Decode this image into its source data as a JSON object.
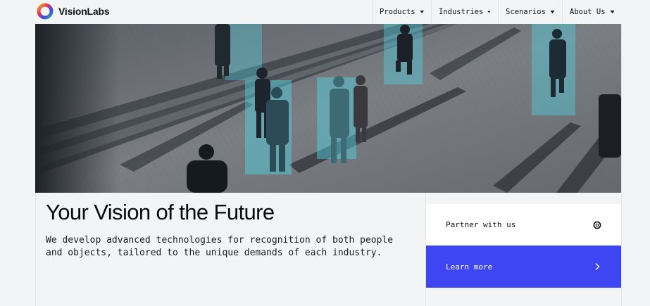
{
  "brand": {
    "name": "VisionLabs",
    "logo_icon": "ring-logo-icon",
    "logo_colors": [
      "#e8344e",
      "#f5a623",
      "#3d46f2",
      "#2bb673"
    ]
  },
  "nav": {
    "items": [
      {
        "label": "Products",
        "icon": "chevron-down-icon"
      },
      {
        "label": "Industries",
        "icon": "chevron-down-icon"
      },
      {
        "label": "Scenarios",
        "icon": "chevron-down-icon"
      },
      {
        "label": "About Us",
        "icon": "chevron-down-icon"
      }
    ]
  },
  "hero": {
    "image_subject": "people walking on plaza steps with cyan detection boxes",
    "highlight_color": "#4fd6e6"
  },
  "main": {
    "headline": "Your Vision of the Future",
    "description": "We develop advanced technologies for recognition of both people and objects, tailored to the unique demands of each industry."
  },
  "cta": {
    "partner_label": "Partner with us",
    "partner_icon": "badge-icon",
    "learn_label": "Learn more",
    "learn_icon": "chevron-right-icon",
    "accent_color": "#3d46f2"
  }
}
